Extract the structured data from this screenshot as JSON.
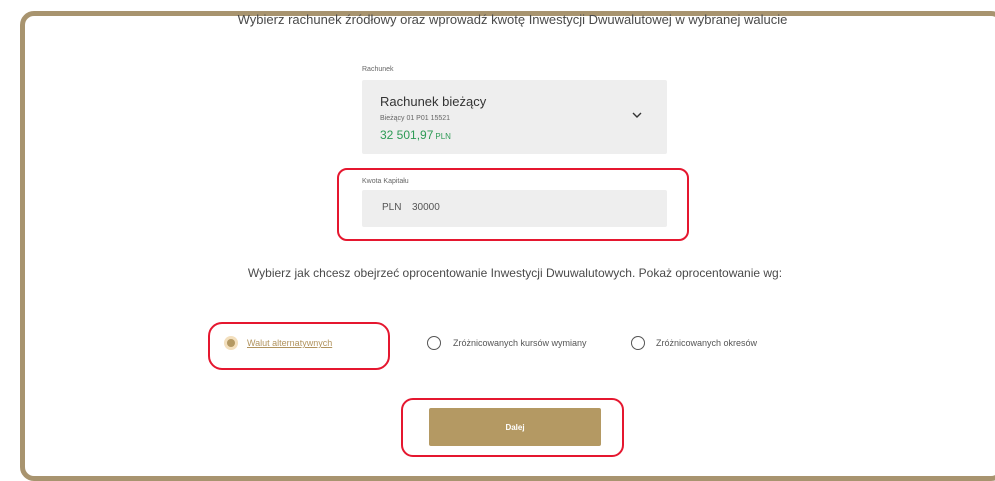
{
  "intro_text": "Wybierz rachunek źródłowy oraz wprowadź kwotę Inwestycji Dwuwalutowej w wybranej walucie",
  "account": {
    "label": "Rachunek",
    "name": "Rachunek bieżący",
    "number": "Bieżący 01 P01 15521",
    "balance": "32 501,97",
    "balance_currency": "PLN"
  },
  "capital": {
    "label": "Kwota Kapitału",
    "currency": "PLN",
    "value": "30000"
  },
  "question": "Wybierz jak chcesz obejrzeć oprocentowanie Inwestycji Dwuwalutowych. Pokaż oprocentowanie wg:",
  "options": [
    {
      "label": "Walut alternatywnych",
      "selected": true
    },
    {
      "label": "Zróżnicowanych kursów wymiany",
      "selected": false
    },
    {
      "label": "Zróżnicowanych okresów",
      "selected": false
    }
  ],
  "next_button": "Dalej",
  "colors": {
    "gold": "#b49963",
    "highlight_red": "#e5172f",
    "balance_green": "#2d9a55",
    "frame": "#a8946f"
  }
}
